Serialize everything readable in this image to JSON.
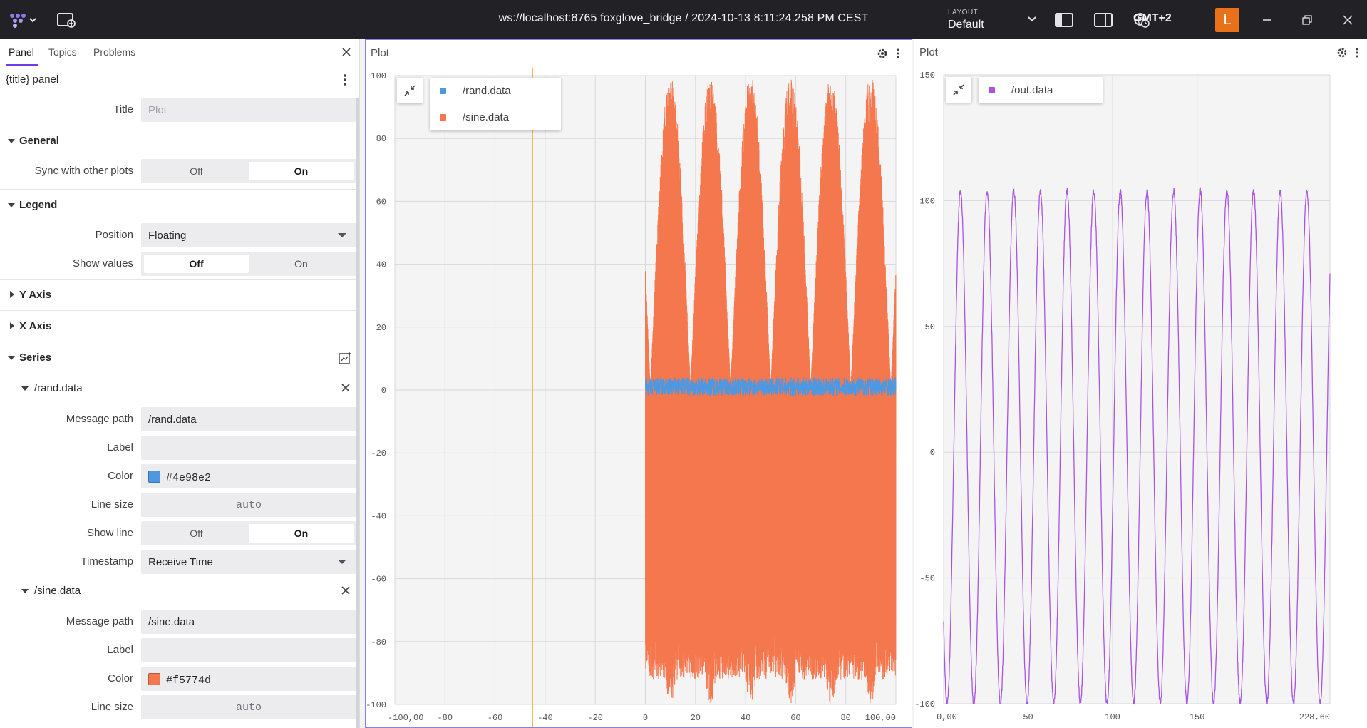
{
  "topbar": {
    "connection_title": "ws://localhost:8765 foxglove_bridge / 2024-10-13 8:11:24.258 PM CEST",
    "layout_caption": "LAYOUT",
    "layout_value": "Default",
    "timezone": "GMT+2",
    "avatar_letter": "L"
  },
  "sidebar": {
    "tabs": [
      "Panel",
      "Topics",
      "Problems"
    ],
    "panel_title": "{title} panel",
    "title_label": "Title",
    "title_placeholder": "Plot",
    "general": {
      "heading": "General",
      "sync_label": "Sync with other plots",
      "off": "Off",
      "on": "On",
      "selected": "On"
    },
    "legend": {
      "heading": "Legend",
      "position_label": "Position",
      "position_value": "Floating",
      "show_values_label": "Show values",
      "off": "Off",
      "on": "On",
      "selected": "Off"
    },
    "y_axis": "Y Axis",
    "x_axis": "X Axis",
    "series_heading": "Series",
    "series": [
      {
        "name": "/rand.data",
        "message_path_label": "Message path",
        "message_path": "/rand.data",
        "label_label": "Label",
        "label_value": "",
        "color_label": "Color",
        "color": "#4e98e2",
        "line_size_label": "Line size",
        "line_size": "auto",
        "show_line_label": "Show line",
        "show_line_off": "Off",
        "show_line_on": "On",
        "show_line_selected": "On",
        "timestamp_label": "Timestamp",
        "timestamp": "Receive Time"
      },
      {
        "name": "/sine.data",
        "message_path_label": "Message path",
        "message_path": "/sine.data",
        "label_label": "Label",
        "label_value": "",
        "color_label": "Color",
        "color": "#f5774d",
        "line_size_label": "Line size",
        "line_size": "auto"
      }
    ]
  },
  "plot_left": {
    "title": "Plot",
    "legend": [
      {
        "name": "/rand.data",
        "color": "#4e98e2"
      },
      {
        "name": "/sine.data",
        "color": "#f5774d"
      }
    ]
  },
  "plot_right": {
    "title": "Plot",
    "legend": [
      {
        "name": "/out.data",
        "color": "#a855e0"
      }
    ]
  },
  "chart_data": [
    {
      "type": "line",
      "title": "",
      "xlim": [
        -100,
        100
      ],
      "ylim": [
        -100,
        100
      ],
      "x_ticks": [
        "-100,00",
        "-80",
        "-60",
        "-40",
        "-20",
        "0",
        "20",
        "40",
        "60",
        "80",
        "100,00"
      ],
      "y_ticks": [
        "100",
        "80",
        "60",
        "40",
        "20",
        "0",
        "-20",
        "-40",
        "-60",
        "-80",
        "-100"
      ],
      "grid": true,
      "legend_position": "top-left (floating)",
      "playhead_x": -45,
      "series": [
        {
          "name": "/rand.data",
          "color": "#4e98e2",
          "x_range": [
            0,
            100
          ],
          "y_range": [
            -2,
            4
          ]
        },
        {
          "name": "/sine.data",
          "color": "#f5774d",
          "x_range": [
            0,
            100
          ],
          "y_range": [
            -100,
            100
          ],
          "peaks_x": [
            10,
            26,
            42,
            58,
            74,
            90
          ]
        }
      ]
    },
    {
      "type": "line",
      "title": "",
      "xlim": [
        0,
        228.6
      ],
      "ylim": [
        -100,
        150
      ],
      "x_ticks": [
        "0,00",
        "50",
        "100",
        "150",
        "228,60"
      ],
      "y_ticks": [
        "150",
        "100",
        "50",
        "0",
        "-50",
        "-100"
      ],
      "grid": true,
      "legend_position": "top-left (floating)",
      "series": [
        {
          "name": "/out.data",
          "color": "#a855e0",
          "y_range": [
            -100,
            104
          ],
          "cycles": 14.5
        }
      ]
    }
  ]
}
